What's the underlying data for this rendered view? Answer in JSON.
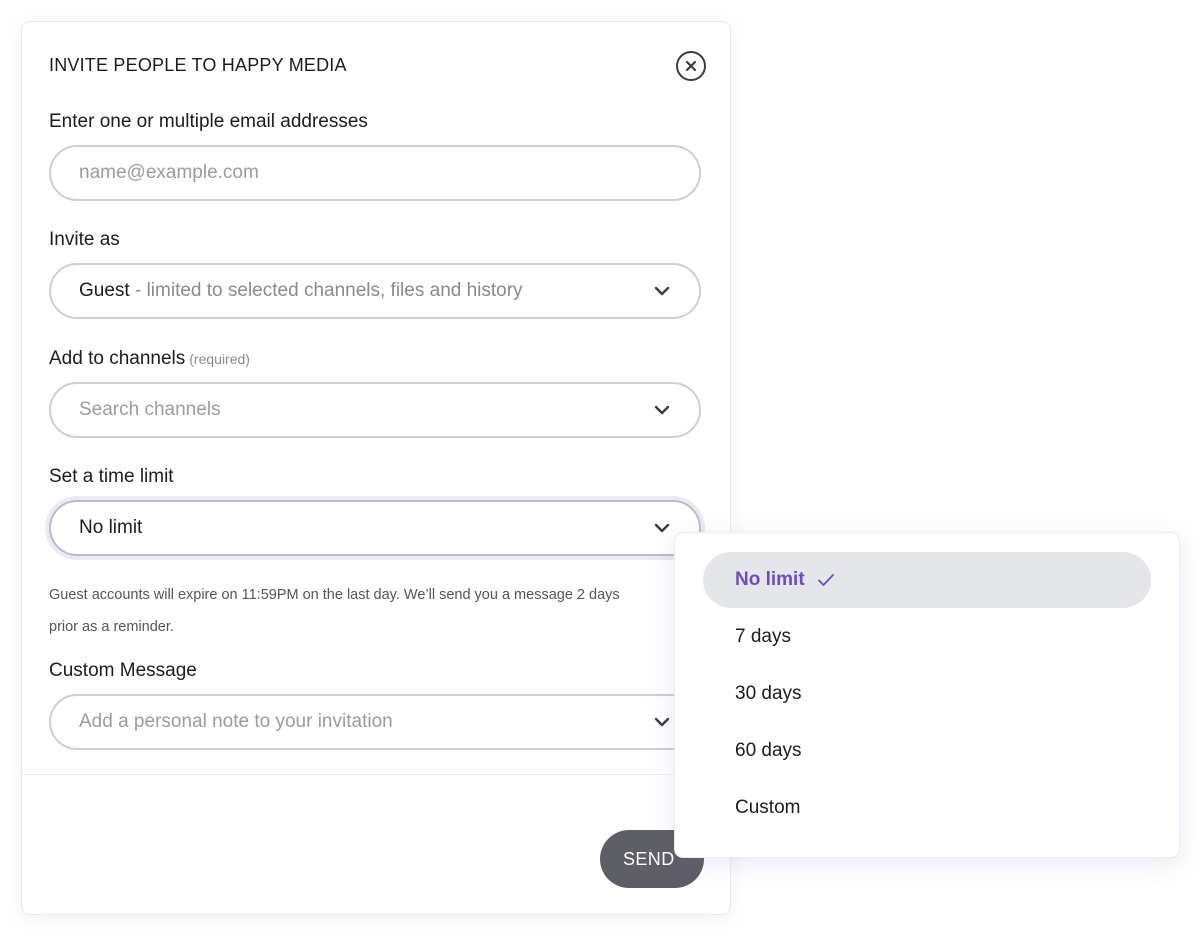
{
  "modal": {
    "title": "INVITE PEOPLE TO HAPPY MEDIA",
    "email": {
      "label": "Enter one or multiple email addresses",
      "placeholder": "name@example.com"
    },
    "invite_as": {
      "label": "Invite as",
      "value_strong": "Guest",
      "value_muted": " - limited to selected channels, files and history"
    },
    "channels": {
      "label": "Add to channels",
      "required": "(required)",
      "placeholder": "Search channels"
    },
    "time_limit": {
      "label": "Set a time limit",
      "value": "No limit",
      "helper_line1": "Guest accounts will expire on 11:59PM on the last day. We’ll send you a message 2 days",
      "helper_line2": "prior as a reminder."
    },
    "custom_message": {
      "label": "Custom Message",
      "placeholder": "Add a personal note to your invitation"
    },
    "send_label": "SEND"
  },
  "dropdown": {
    "options": [
      {
        "label": "No limit",
        "selected": true
      },
      {
        "label": "7 days",
        "selected": false
      },
      {
        "label": "30 days",
        "selected": false
      },
      {
        "label": "60 days",
        "selected": false
      },
      {
        "label": "Custom",
        "selected": false
      }
    ]
  },
  "colors": {
    "accent": "#6e4cbf",
    "send_button": "#5e5e66",
    "field_border": "#c9d0d6",
    "selected_option_bg": "#e4e6ea"
  },
  "icons": {
    "close": "close-icon",
    "chevron": "chevron-down-icon",
    "check": "check-icon"
  }
}
